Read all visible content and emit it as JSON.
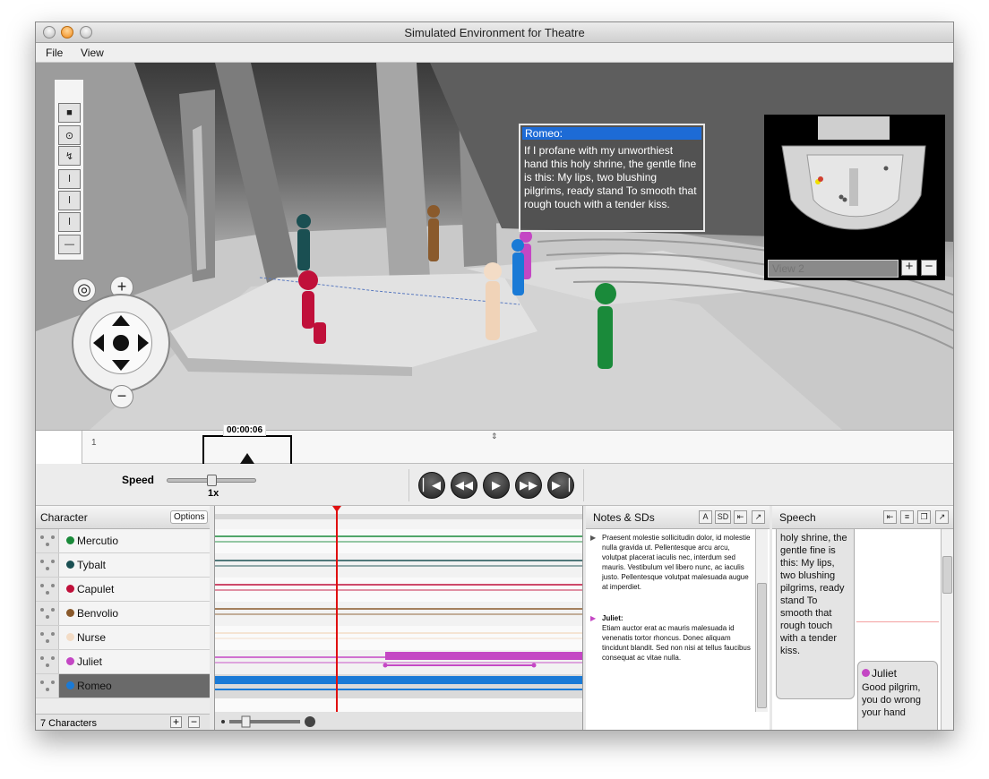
{
  "window": {
    "title": "Simulated Environment for Theatre"
  },
  "menu": {
    "items": [
      "File",
      "View"
    ]
  },
  "bubble": {
    "speaker": "Romeo:",
    "text": "If I profane with my unworthiest hand this holy shrine, the gentle fine is this: My lips, two blushing pilgrims, ready stand To smooth that rough touch with a tender kiss."
  },
  "minimap": {
    "view_placeholder": "View 2",
    "plus": "+",
    "minus": "−"
  },
  "nav": {
    "zoom_in": "+",
    "zoom_out": "−"
  },
  "timeline": {
    "current_time": "00:00:06",
    "ruler_mark": "1"
  },
  "speed": {
    "label": "Speed",
    "value": "1x"
  },
  "characters": {
    "header": "Character",
    "options_label": "Options",
    "footer": "7 Characters",
    "items": [
      {
        "name": "Mercutio",
        "color": "#1a8a3a"
      },
      {
        "name": "Tybalt",
        "color": "#1a4f52"
      },
      {
        "name": "Capulet",
        "color": "#c0103a"
      },
      {
        "name": "Benvolio",
        "color": "#8a5a2c"
      },
      {
        "name": "Nurse",
        "color": "#f3dcc6"
      },
      {
        "name": "Juliet",
        "color": "#c447c4"
      },
      {
        "name": "Romeo",
        "color": "#1a7ad6"
      }
    ]
  },
  "notes": {
    "header": "Notes & SDs",
    "btn_a": "A",
    "btn_sd": "SD",
    "entries": [
      {
        "speaker": "",
        "text": "Praesent molestie sollicitudin dolor, id molestie nulla gravida ut. Pellentesque arcu arcu, volutpat placerat iaculis nec, interdum sed mauris. Vestibulum vel libero nunc, ac iaculis justo. Pellentesque volutpat malesuada augue at imperdiet."
      },
      {
        "speaker": "Juliet:",
        "text": "Etiam auctor erat ac mauris malesuada id venenatis tortor rhoncus. Donec aliquam tincidunt blandit. Sed non nisi at tellus faucibus consequat ac vitae nulla."
      }
    ]
  },
  "speech": {
    "header": "Speech",
    "romeo_text": "holy shrine, the gentle fine is this: My lips, two blushing pilgrims, ready stand To smooth that rough touch with a tender kiss.",
    "juliet_name": "Juliet",
    "juliet_text": "Good pilgrim, you do wrong your hand"
  }
}
